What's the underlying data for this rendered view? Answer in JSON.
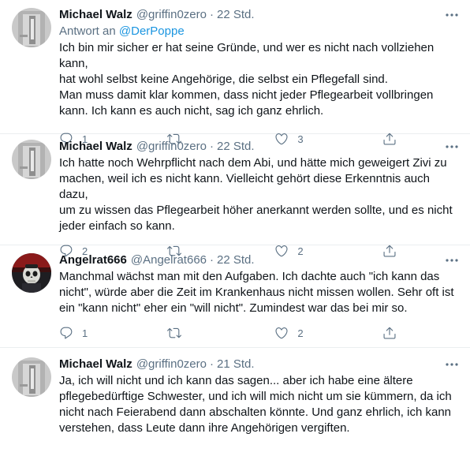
{
  "tweets": [
    {
      "author": "Michael Walz",
      "handle": "@griffin0zero",
      "separator": "·",
      "time": "22 Std.",
      "reply_prefix": "Antwort an",
      "reply_handle": "@DerPoppe",
      "lines": [
        "Ich bin mir sicher er hat seine Gründe, und wer es nicht nach vollziehen kann,",
        "hat wohl selbst keine Angehörige, die selbst ein Pflegefall sind.",
        "Man muss damit klar kommen, dass nicht jeder Pflegearbeit vollbringen",
        "kann. Ich kann es auch nicht, sag ich ganz ehrlich."
      ],
      "replies": "1",
      "retweets": "",
      "likes": "3",
      "avatar_icon": "default-avatar-icon"
    },
    {
      "author": "Michael Walz",
      "handle": "@griffin0zero",
      "separator": "·",
      "time": "22 Std.",
      "lines": [
        "Ich hatte noch Wehrpflicht nach dem Abi, und hätte mich geweigert Zivi zu",
        "machen, weil ich es nicht kann. Vielleicht gehört diese Erkenntnis auch dazu,",
        "um zu wissen das Pflegearbeit höher anerkannt werden sollte, und es nicht",
        "jeder einfach so kann."
      ],
      "replies": "2",
      "retweets": "",
      "likes": "2",
      "avatar_icon": "default-avatar-icon"
    },
    {
      "author": "Angelrat666",
      "handle": "@Angelrat666",
      "separator": "·",
      "time": "22 Std.",
      "lines": [
        "Manchmal wächst man mit den Aufgaben. Ich dachte auch \"ich kann das",
        "nicht\", würde aber die Zeit im Krankenhaus nicht missen wollen. Sehr oft ist",
        "ein \"kann nicht\" eher ein \"will nicht\". Zumindest war das bei mir so."
      ],
      "replies": "1",
      "retweets": "",
      "likes": "2",
      "avatar_icon": "skull-avatar-icon"
    },
    {
      "author": "Michael Walz",
      "handle": "@griffin0zero",
      "separator": "·",
      "time": "21 Std.",
      "lines": [
        "Ja, ich will nicht und ich kann das sagen... aber ich habe eine ältere",
        "pflegebedürftige Schwester, und ich will mich nicht um sie kümmern, da ich",
        "nicht nach Feierabend dann abschalten könnte. Und ganz ehrlich, ich kann",
        "verstehen, dass Leute dann ihre Angehörigen vergiften."
      ],
      "avatar_icon": "default-avatar-icon"
    }
  ],
  "colors": {
    "text": "#0f1419",
    "secondary": "#5b7083",
    "link": "#1b95e0",
    "divider": "#ebeef0"
  }
}
